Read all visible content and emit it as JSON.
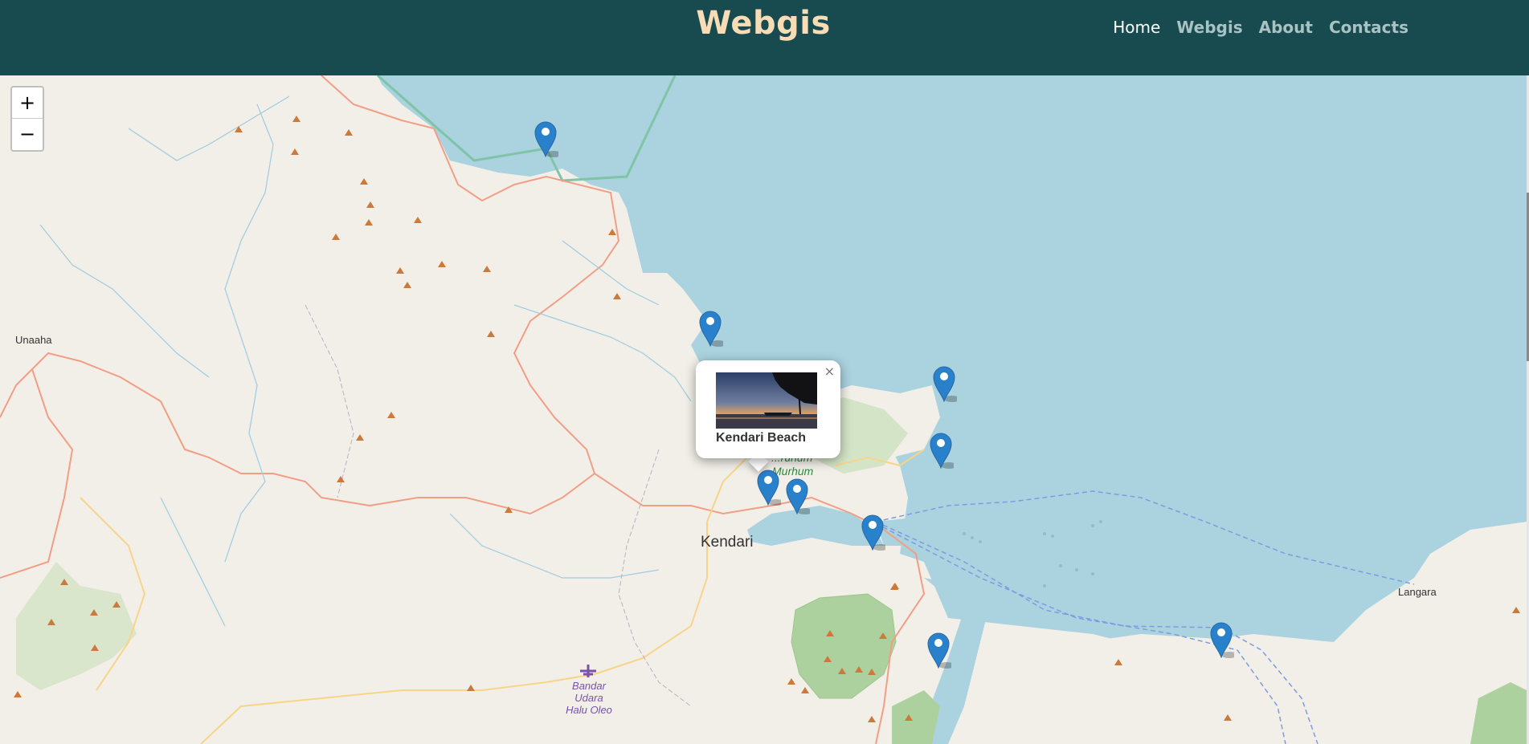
{
  "brand": "Webgis",
  "nav": [
    {
      "label": "Home",
      "active": true
    },
    {
      "label": "Webgis",
      "active": false
    },
    {
      "label": "About",
      "active": false
    },
    {
      "label": "Contacts",
      "active": false
    }
  ],
  "zoom": {
    "in": "+",
    "out": "−"
  },
  "map_labels": {
    "city": "Kendari",
    "unaaha": "Unaaha",
    "langara": "Langara",
    "airport": [
      "Bandar",
      "Udara",
      "Halu Oleo"
    ],
    "park_line1": "...ruhum",
    "park_line2": "Murhum"
  },
  "popup": {
    "title": "Kendari Beach",
    "close": "×"
  },
  "colors": {
    "navbar": "#174b50",
    "brand": "#f8dcb6",
    "sea": "#aad3df",
    "land": "#f2efe9",
    "forest": "#add19e",
    "marker": "#2a81cb"
  },
  "icons": {
    "marker": "map-marker-icon",
    "peak": "peak-triangle-icon",
    "airport": "airplane-icon"
  },
  "markers": [
    {
      "name": "marker-1"
    },
    {
      "name": "marker-2"
    },
    {
      "name": "marker-3"
    },
    {
      "name": "marker-4"
    },
    {
      "name": "marker-5"
    },
    {
      "name": "marker-6"
    },
    {
      "name": "marker-7"
    },
    {
      "name": "marker-8"
    },
    {
      "name": "marker-9"
    }
  ]
}
